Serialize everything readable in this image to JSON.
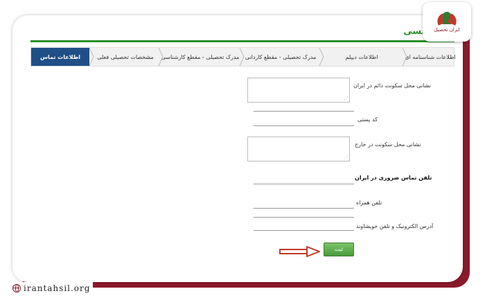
{
  "logo": {
    "text": "ایران تحصیل"
  },
  "watermark": {
    "site": "irantahsil.org"
  },
  "page": {
    "title": "حسی"
  },
  "tabs": [
    {
      "label": "اطلاعات شناسنامه ای",
      "active": false
    },
    {
      "label": "اطلاعات دیپلم",
      "active": false
    },
    {
      "label": "مدرک تحصیلی - مقطع کاردانی",
      "active": false
    },
    {
      "label": "مدرک تحصیلی - مقطع کارشناسی",
      "active": false
    },
    {
      "label": "مشخصات تحصیلی فعلی",
      "active": false
    },
    {
      "label": "اطلاعات تماس",
      "active": true
    }
  ],
  "form": {
    "address_label": "نشانی محل سکونت دائم در ایران",
    "postal_label": "کد پستی",
    "foreign_address_label": "نشانی محل سکونت در خارج",
    "emergency_heading": "تلفن تماس ضروری در ایران",
    "phone_label": "تلفن همراه",
    "relative_label": "آدرس الکترونیک و تلفن خویشاوند",
    "submit_label": "ثبت"
  },
  "colors": {
    "accent_green": "#2a8f2a",
    "tab_active": "#1f4f86",
    "frame": "#8b1a2b",
    "arrow": "#c0392b"
  }
}
